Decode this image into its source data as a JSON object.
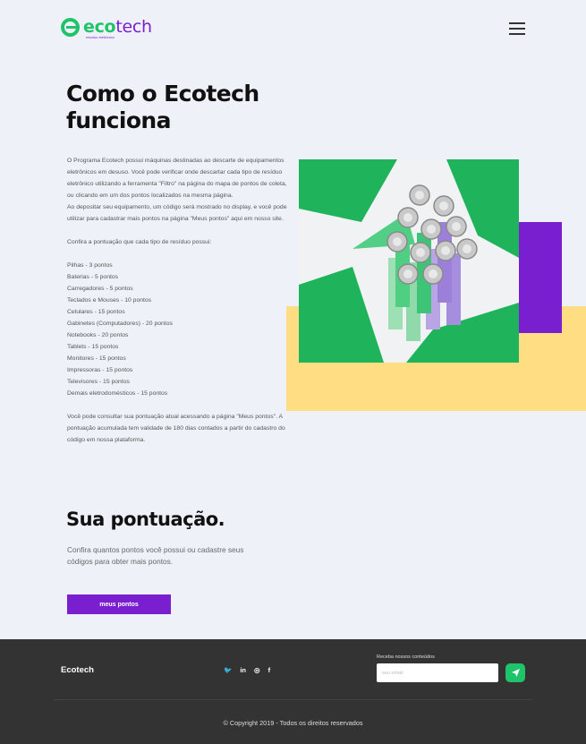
{
  "header": {
    "logo_eco": "eco",
    "logo_tech": "tech",
    "logo_tagline": "resíduo eletrônico",
    "menu_icon": "hamburger-menu-icon"
  },
  "main": {
    "title": "Como o Ecotech funciona",
    "intro_paragraphs": [
      "O Programa Ecotech possui máquinas destinadas ao descarte de equipamentos eletrônicos em desuso. Você pode verificar onde descartar cada tipo de resíduo eletrônico utilizando a ferramenta \"Filtro\" na página do mapa de pontos de coleta, ou clicando em um dos pontos localizados na mesma página.",
      "Ao depositar seu equipamento, um código será mostrado no display, e você pode utilizar para cadastrar mais pontos na página \"Meus pontos\" aqui em nosso site.",
      "Confira a pontuação que cada tipo de resíduo possui:"
    ],
    "points": [
      "Pilhas - 3 pontos",
      "Baterias - 5 pontos",
      "Carregadores - 5 pontos",
      "Teclados e Mouses - 10 pontos",
      "Celulares - 15 pontos",
      "Gabinetes (Computadores) - 20 pontos",
      "Notebooks - 20 pontos",
      "Tablets - 15 pontos",
      "Monitores - 15 pontos",
      "Impressoras  - 15 pontos",
      "Televisores  - 15 pontos",
      "Demais eletrodomésticos - 15 pontos"
    ],
    "closing_paragraph": "Você pode consultar sua pontuação atual acessando a página \"Meus pontos\". A pontuação acumulada tem validade de 180 dias contados a partir do cadastro do código em nossa plataforma."
  },
  "score": {
    "title": "Sua pontuação.",
    "text": "Confira quantos pontos você possui ou cadastre seus códigos para obter mais pontos.",
    "button_label": "meus pontos"
  },
  "footer": {
    "brand": "Ecotech",
    "social": [
      {
        "icon": "twitter-icon",
        "glyph": "🐦"
      },
      {
        "icon": "linkedin-icon",
        "glyph": "in"
      },
      {
        "icon": "instagram-icon",
        "glyph": "◎"
      },
      {
        "icon": "facebook-icon",
        "glyph": "f"
      }
    ],
    "newsletter_label": "Receba nossos conteúdos",
    "newsletter_placeholder": "seu email",
    "copyright": "© Copyright 2019 - Todos os direitos reservados"
  },
  "colors": {
    "background": "#eef2f8",
    "green": "#1fc46a",
    "purple": "#7a1fcf",
    "yellow": "#ffdd82",
    "footer": "#333333"
  }
}
